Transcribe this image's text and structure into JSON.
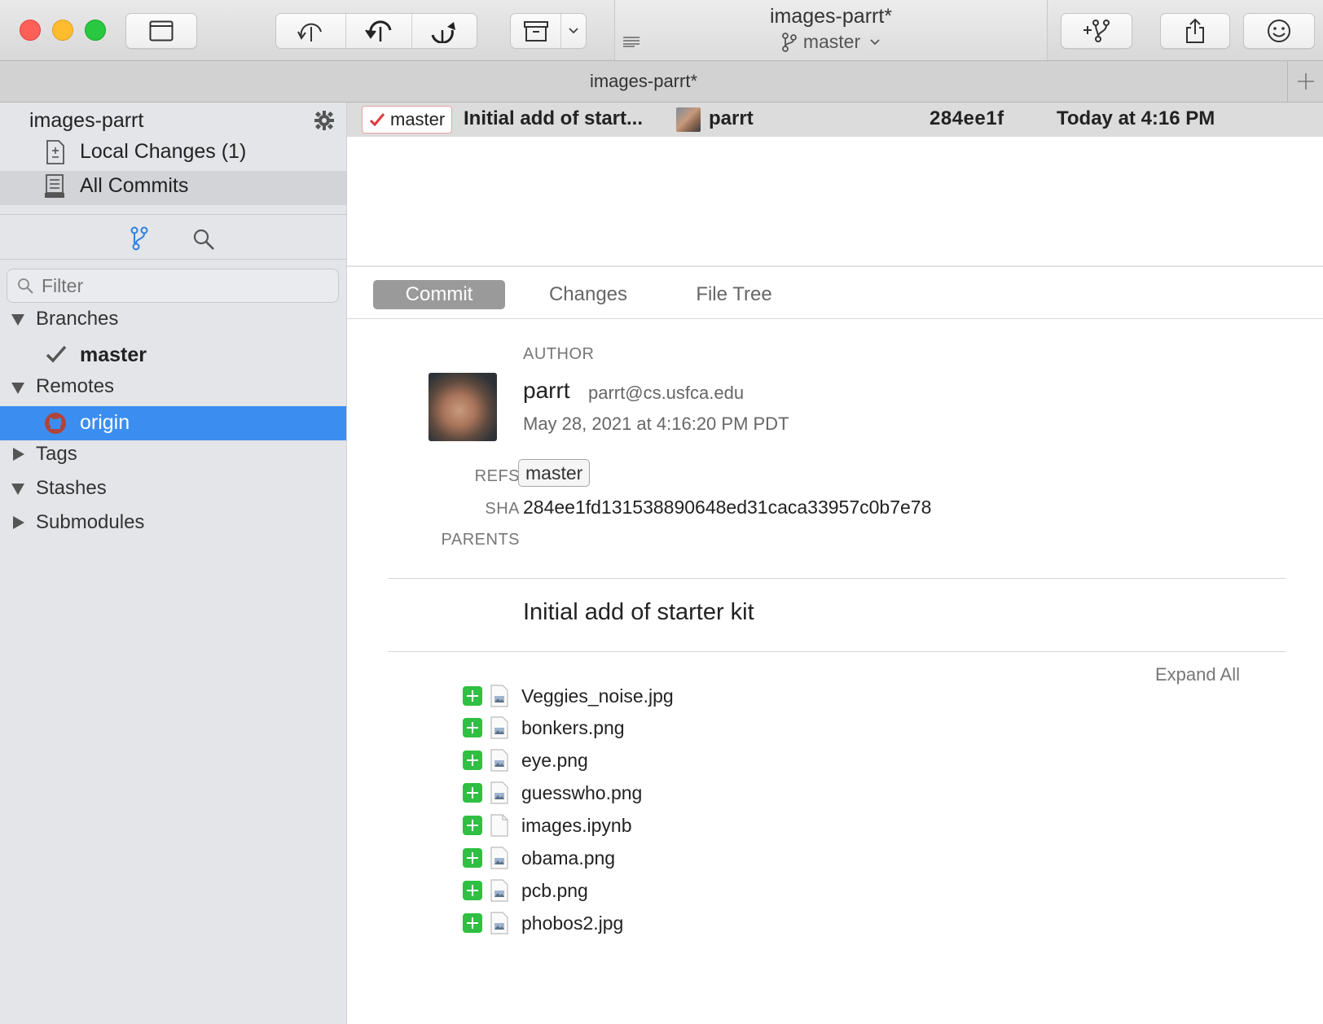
{
  "window": {
    "title": "images-parrt*",
    "branch": "master",
    "tab_title": "images-parrt*"
  },
  "sidebar": {
    "repo_name": "images-parrt",
    "local_changes": "Local Changes (1)",
    "all_commits": "All Commits",
    "filter_placeholder": "Filter",
    "sections": {
      "branches": "Branches",
      "branch_master": "master",
      "remotes": "Remotes",
      "remote_origin": "origin",
      "tags": "Tags",
      "stashes": "Stashes",
      "submodules": "Submodules"
    }
  },
  "commit_row": {
    "ref": "master",
    "message": "Initial add of start...",
    "author": "parrt",
    "sha": "284ee1f",
    "date": "Today at 4:16 PM"
  },
  "tabs": {
    "commit": "Commit",
    "changes": "Changes",
    "file_tree": "File Tree"
  },
  "detail": {
    "author_label": "AUTHOR",
    "author_name": "parrt",
    "author_email": "parrt@cs.usfca.edu",
    "date": "May 28, 2021 at 4:16:20 PM PDT",
    "refs_label": "REFS",
    "refs_value": "master",
    "sha_label": "SHA",
    "sha_value": "284ee1fd131538890648ed31caca33957c0b7e78",
    "parents_label": "PARENTS",
    "message": "Initial add of starter kit",
    "expand_all": "Expand All",
    "files": [
      {
        "name": "Veggies_noise.jpg",
        "type": "image"
      },
      {
        "name": "bonkers.png",
        "type": "image"
      },
      {
        "name": "eye.png",
        "type": "image"
      },
      {
        "name": "guesswho.png",
        "type": "image"
      },
      {
        "name": "images.ipynb",
        "type": "document"
      },
      {
        "name": "obama.png",
        "type": "image"
      },
      {
        "name": "pcb.png",
        "type": "image"
      },
      {
        "name": "phobos2.jpg",
        "type": "image"
      }
    ]
  },
  "colors": {
    "accent": "#3b8ef0",
    "selection": "#3b8ef0",
    "added": "#2fbf42",
    "ref_check": "#e0393e"
  }
}
